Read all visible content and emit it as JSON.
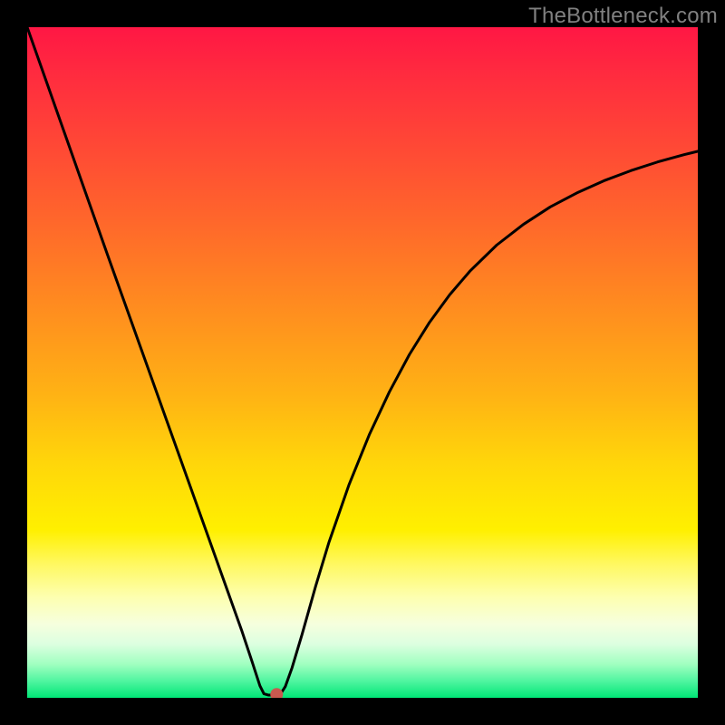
{
  "watermark": "TheBottleneck.com",
  "chart_data": {
    "type": "line",
    "title": "",
    "xlabel": "",
    "ylabel": "",
    "x_range": [
      0,
      100
    ],
    "y_range": [
      0,
      100
    ],
    "background_gradient": {
      "stops": [
        {
          "offset": 0.0,
          "color": "#ff1744"
        },
        {
          "offset": 0.07,
          "color": "#ff2b3f"
        },
        {
          "offset": 0.18,
          "color": "#ff4935"
        },
        {
          "offset": 0.3,
          "color": "#ff6a2a"
        },
        {
          "offset": 0.42,
          "color": "#ff8d1f"
        },
        {
          "offset": 0.55,
          "color": "#ffb314"
        },
        {
          "offset": 0.65,
          "color": "#ffd60a"
        },
        {
          "offset": 0.75,
          "color": "#fff000"
        },
        {
          "offset": 0.8,
          "color": "#fff860"
        },
        {
          "offset": 0.85,
          "color": "#fdffb0"
        },
        {
          "offset": 0.89,
          "color": "#f6ffde"
        },
        {
          "offset": 0.92,
          "color": "#dcffe0"
        },
        {
          "offset": 0.95,
          "color": "#a0ffc0"
        },
        {
          "offset": 0.975,
          "color": "#50f5a0"
        },
        {
          "offset": 1.0,
          "color": "#00e676"
        }
      ]
    },
    "curve": {
      "description": "V-shaped bottleneck curve, left branch nearly linear descending, right branch concave increasing",
      "points": [
        {
          "x": 0.0,
          "y": 100.0
        },
        {
          "x": 3.0,
          "y": 91.5
        },
        {
          "x": 6.0,
          "y": 83.0
        },
        {
          "x": 9.0,
          "y": 74.5
        },
        {
          "x": 12.0,
          "y": 66.0
        },
        {
          "x": 15.0,
          "y": 57.6
        },
        {
          "x": 18.0,
          "y": 49.2
        },
        {
          "x": 21.0,
          "y": 40.8
        },
        {
          "x": 24.0,
          "y": 32.4
        },
        {
          "x": 27.0,
          "y": 24.0
        },
        {
          "x": 30.0,
          "y": 15.6
        },
        {
          "x": 32.0,
          "y": 10.0
        },
        {
          "x": 33.5,
          "y": 5.5
        },
        {
          "x": 34.7,
          "y": 1.8
        },
        {
          "x": 35.3,
          "y": 0.6
        },
        {
          "x": 36.0,
          "y": 0.4
        },
        {
          "x": 37.0,
          "y": 0.4
        },
        {
          "x": 37.8,
          "y": 0.6
        },
        {
          "x": 38.5,
          "y": 1.7
        },
        {
          "x": 39.5,
          "y": 4.5
        },
        {
          "x": 41.0,
          "y": 9.5
        },
        {
          "x": 43.0,
          "y": 16.6
        },
        {
          "x": 45.0,
          "y": 23.2
        },
        {
          "x": 48.0,
          "y": 31.8
        },
        {
          "x": 51.0,
          "y": 39.2
        },
        {
          "x": 54.0,
          "y": 45.6
        },
        {
          "x": 57.0,
          "y": 51.2
        },
        {
          "x": 60.0,
          "y": 56.0
        },
        {
          "x": 63.0,
          "y": 60.1
        },
        {
          "x": 66.0,
          "y": 63.6
        },
        {
          "x": 70.0,
          "y": 67.5
        },
        {
          "x": 74.0,
          "y": 70.6
        },
        {
          "x": 78.0,
          "y": 73.2
        },
        {
          "x": 82.0,
          "y": 75.3
        },
        {
          "x": 86.0,
          "y": 77.1
        },
        {
          "x": 90.0,
          "y": 78.6
        },
        {
          "x": 94.0,
          "y": 79.9
        },
        {
          "x": 98.0,
          "y": 81.0
        },
        {
          "x": 100.0,
          "y": 81.5
        }
      ]
    },
    "marker": {
      "x": 37.2,
      "y": 0.5,
      "color": "#c9594f",
      "radius_px": 7
    }
  }
}
